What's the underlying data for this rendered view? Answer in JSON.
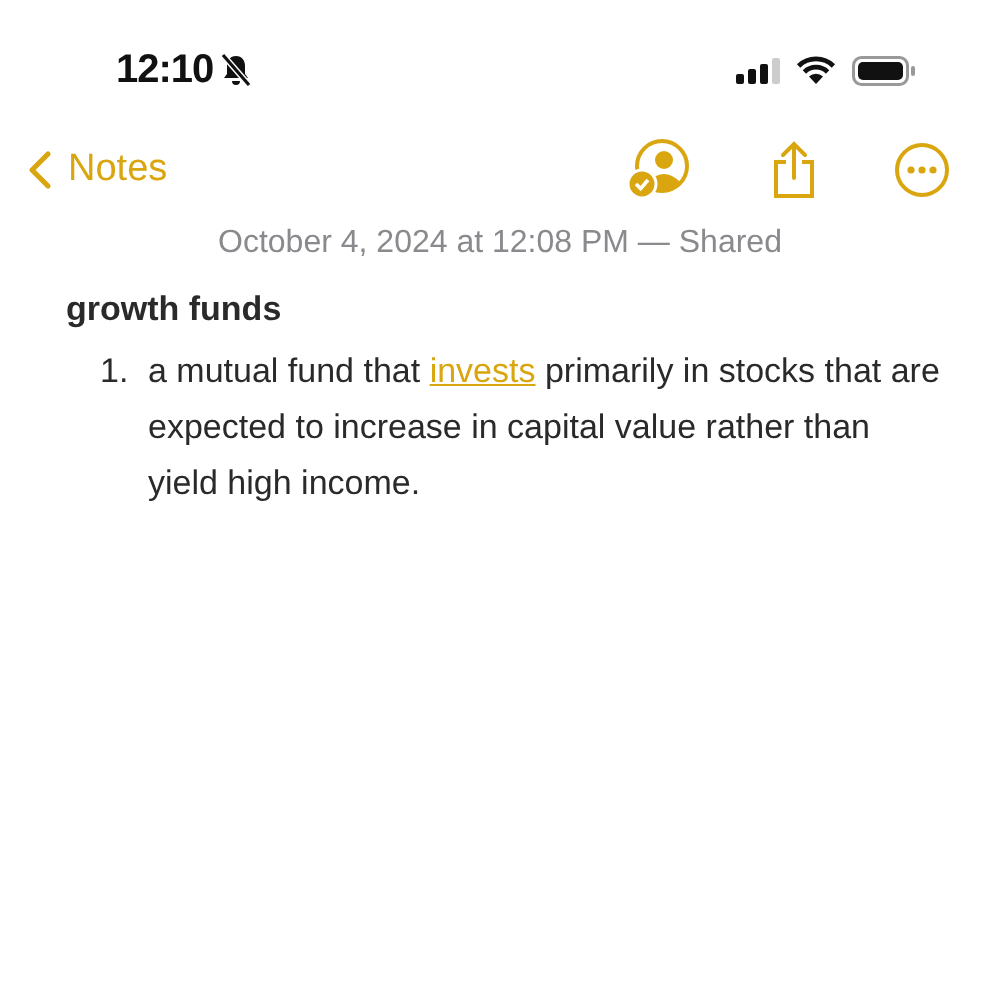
{
  "status_bar": {
    "time": "12:10",
    "silent": true
  },
  "nav": {
    "back_label": "Notes"
  },
  "note": {
    "date": "October 4, 2024 at 12:08 PM — Shared",
    "title": "growth funds",
    "list": [
      {
        "number": "1.",
        "before": "a mutual fund that ",
        "link": "invests",
        "after": " primarily in stocks that are expected to increase in capital value rather than yield high income."
      }
    ]
  }
}
